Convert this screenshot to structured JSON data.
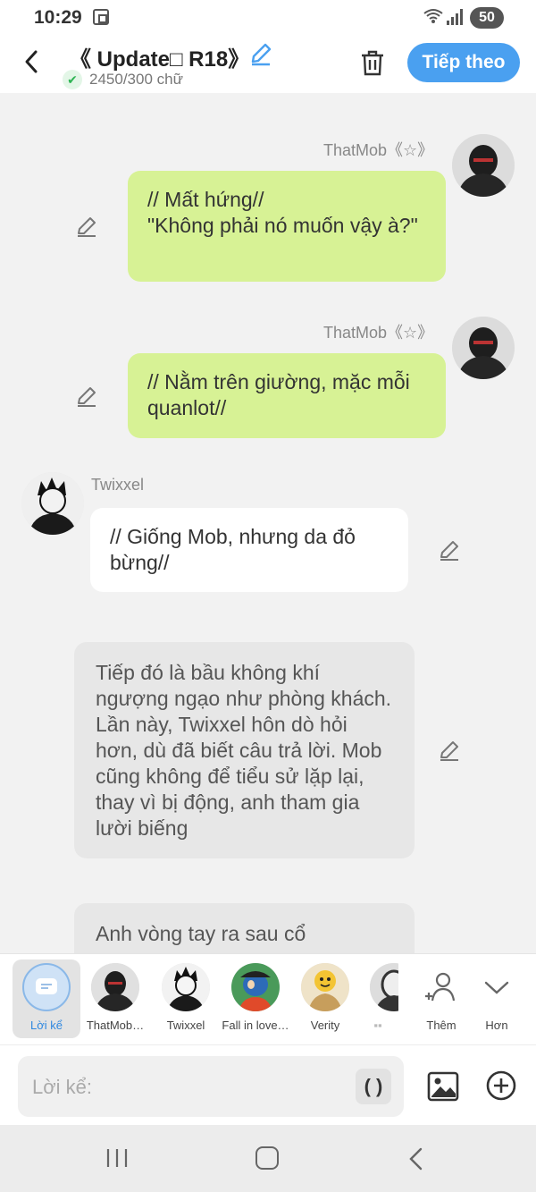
{
  "status": {
    "time": "10:29",
    "battery": "50"
  },
  "header": {
    "title": "《 Update□ R18》",
    "word_count": "2450/300 chữ",
    "next_label": "Tiếp theo"
  },
  "messages": [
    {
      "speaker": "ThatMob《☆》",
      "text": "// Mất hứng//\n\"Không phải nó muốn vậy à?\""
    },
    {
      "speaker": "ThatMob《☆》",
      "text": "// Nằm trên giường, mặc mỗi quanlot//"
    },
    {
      "speaker": "Twixxel",
      "text": "// Giống Mob, nhưng da đỏ bừng//"
    },
    {
      "text": "Tiếp đó là bầu không khí ngượng ngạo như phòng khách. Lần này, Twixxel hôn dò hỏi hơn, dù đã biết câu trả lời. Mob cũng không để tiểu sử lặp lại, thay vì bị động, anh tham gia lười biếng"
    },
    {
      "text": "Anh vòng tay ra sau cổ"
    }
  ],
  "characters": {
    "narration_label": "Lời kể",
    "items": [
      "ThatMob…",
      "Twixxel",
      "Fall in love…",
      "Verity"
    ],
    "add_label": "Thêm",
    "more_label": "Hơn"
  },
  "input": {
    "placeholder": "Lời kể:",
    "paren": "( )"
  }
}
